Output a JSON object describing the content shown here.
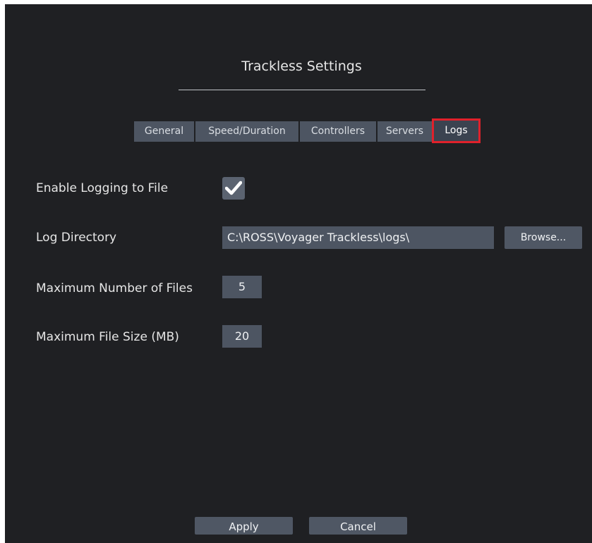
{
  "dialog": {
    "title": "Trackless Settings"
  },
  "tabs": [
    {
      "label": "General",
      "active": false
    },
    {
      "label": "Speed/Duration",
      "active": false
    },
    {
      "label": "Controllers",
      "active": false
    },
    {
      "label": "Servers",
      "active": false
    },
    {
      "label": "Logs",
      "active": true
    }
  ],
  "logs": {
    "enable_logging": {
      "label": "Enable Logging to File",
      "checked": true,
      "icon": "checkmark-icon"
    },
    "log_directory": {
      "label": "Log Directory",
      "value": "C:\\ROSS\\Voyager Trackless\\logs\\",
      "browse_label": "Browse..."
    },
    "max_files": {
      "label": "Maximum Number of Files",
      "value": "5"
    },
    "max_file_size": {
      "label": "Maximum File Size (MB)",
      "value": "20"
    }
  },
  "footer": {
    "apply_label": "Apply",
    "cancel_label": "Cancel"
  },
  "colors": {
    "background": "#1f2023",
    "control": "#4d5562",
    "highlight": "#e0212b",
    "text": "#e6e6e6"
  }
}
